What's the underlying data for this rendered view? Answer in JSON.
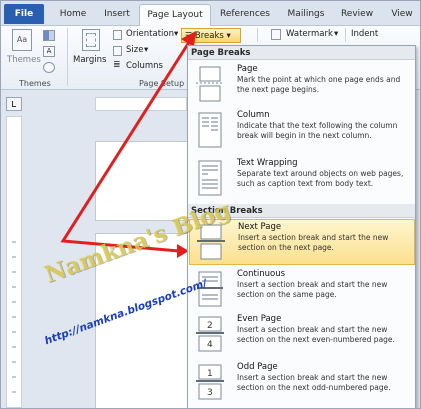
{
  "tabs": [
    "File",
    "Home",
    "Insert",
    "Page Layout",
    "References",
    "Mailings",
    "Review",
    "View"
  ],
  "ribbon": {
    "themes_label": "Themes",
    "themes_group": "Themes",
    "margins_label": "Margins",
    "orientation_label": "Orientation",
    "size_label": "Size",
    "columns_label": "Columns",
    "page_setup_group": "Page Setup",
    "breaks_label": "Breaks",
    "watermark_label": "Watermark",
    "indent_label": "Indent"
  },
  "menu": {
    "page_breaks_header": "Page Breaks",
    "section_breaks_header": "Section Breaks",
    "items": [
      {
        "title": "Page",
        "desc": "Mark the point at which one page ends and the next page begins."
      },
      {
        "title": "Column",
        "desc": "Indicate that the text following the column break will begin in the next column."
      },
      {
        "title": "Text Wrapping",
        "desc": "Separate text around objects on web pages, such as caption text from body text."
      },
      {
        "title": "Next Page",
        "desc": "Insert a section break and start the new section on the next page."
      },
      {
        "title": "Continuous",
        "desc": "Insert a section break and start the new section on the same page."
      },
      {
        "title": "Even Page",
        "desc": "Insert a section break and start the new section on the next even-numbered page."
      },
      {
        "title": "Odd Page",
        "desc": "Insert a section break and start the new section on the next odd-numbered page."
      }
    ]
  },
  "watermark": {
    "blog_text": "Namkna's Blog",
    "url_text": "http://namkna.blogspot.com/"
  },
  "colors": {
    "file_tab": "#2a5fb0",
    "highlight": "#fbe08e",
    "arrow": "#e02020"
  }
}
